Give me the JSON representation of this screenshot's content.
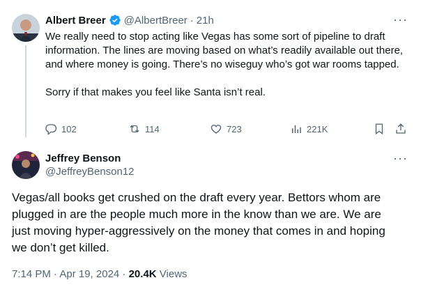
{
  "tweet1": {
    "author_name": "Albert Breer",
    "handle": "@AlbertBreer",
    "separator": "·",
    "time": "21h",
    "text_p1": "We really need to stop acting like Vegas has some sort of pipeline to draft information. The lines are moving based on what’s readily available out there, and where money is going. There’s no wiseguy who’s got war rooms tapped.",
    "text_p2": "Sorry if that makes you feel like Santa isn’t real.",
    "replies": "102",
    "reposts": "114",
    "likes": "723",
    "views": "221K",
    "verified_color": "#1d9bf0"
  },
  "tweet2": {
    "author_name": "Jeffrey Benson",
    "handle": "@JeffreyBenson12",
    "text": "Vegas/all books get crushed on the draft every year. Bettors whom are plugged in are the people much more in the know than we are. We are just moving hyper-aggressively on the money that comes in and hoping we don’t get killed.",
    "timestamp": "7:14 PM · Apr 19, 2024 · ",
    "views_count": "20.4K",
    "views_label": " Views"
  },
  "colors": {
    "text": "#0f1419",
    "muted": "#536471",
    "accent": "#1d9bf0"
  }
}
